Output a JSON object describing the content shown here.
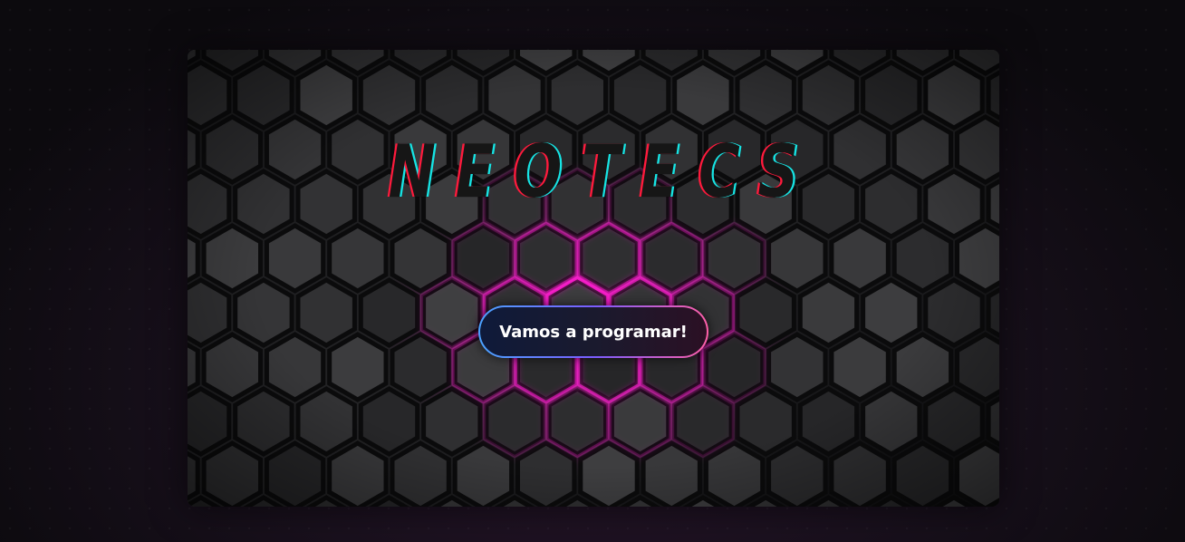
{
  "hero": {
    "title": "NEOTECS",
    "cta_label": "Vamos a programar!"
  },
  "colors": {
    "page_background": "#0f0c12",
    "accent_pink": "#ff1fd0",
    "accent_red": "#ff1a3c",
    "accent_cyan": "#16e4e4",
    "button_border_start": "#4aa3ff",
    "button_border_end": "#ff5fa8"
  },
  "icons": {
    "background": "glowing-hexagon-pattern"
  }
}
